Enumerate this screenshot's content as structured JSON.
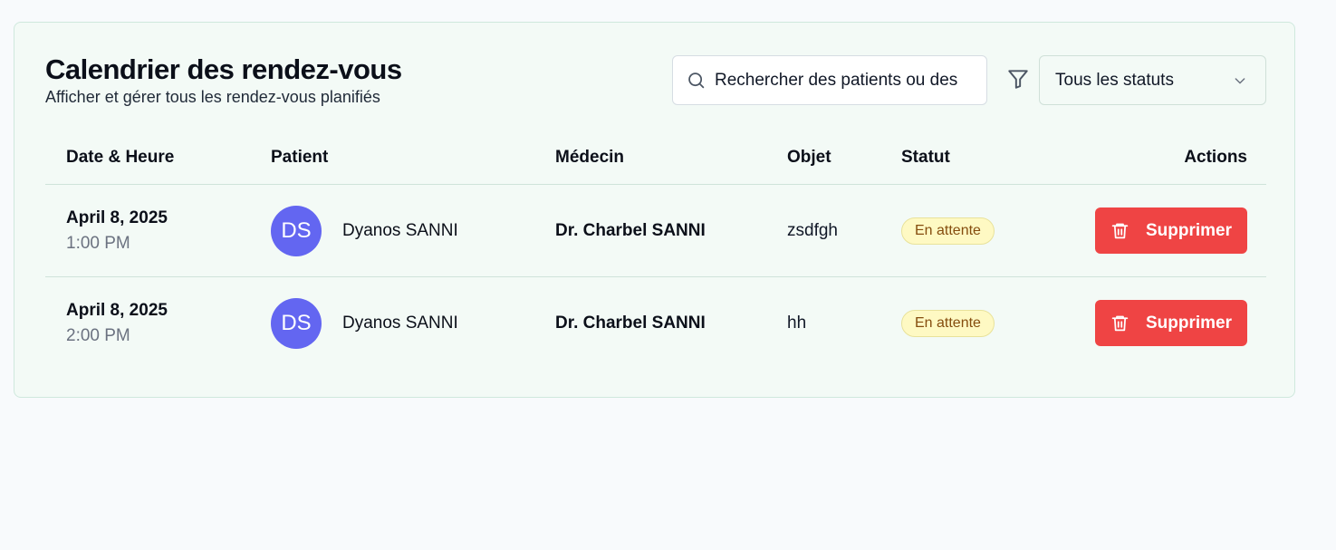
{
  "header": {
    "title": "Calendrier des rendez-vous",
    "subtitle": "Afficher et gérer tous les rendez-vous planifiés"
  },
  "search": {
    "placeholder": "Rechercher des patients ou des"
  },
  "filter": {
    "icon": "filter-icon",
    "status_select": "Tous les statuts"
  },
  "table": {
    "columns": {
      "date": "Date & Heure",
      "patient": "Patient",
      "doctor": "Médecin",
      "object": "Objet",
      "status": "Statut",
      "actions": "Actions"
    },
    "rows": [
      {
        "date": "April 8, 2025",
        "time": "1:00 PM",
        "initials": "DS",
        "patient": "Dyanos SANNI",
        "doctor": "Dr. Charbel SANNI",
        "object": "zsdfgh",
        "status": "En attente",
        "action": "Supprimer"
      },
      {
        "date": "April 8, 2025",
        "time": "2:00 PM",
        "initials": "DS",
        "patient": "Dyanos SANNI",
        "doctor": "Dr. Charbel SANNI",
        "object": "hh",
        "status": "En attente",
        "action": "Supprimer"
      }
    ]
  },
  "colors": {
    "avatar": "#6366f1",
    "delete_button": "#ef4444",
    "badge_background": "#fef9c3",
    "badge_text": "#854d0e",
    "card_background": "#f3faf6"
  }
}
